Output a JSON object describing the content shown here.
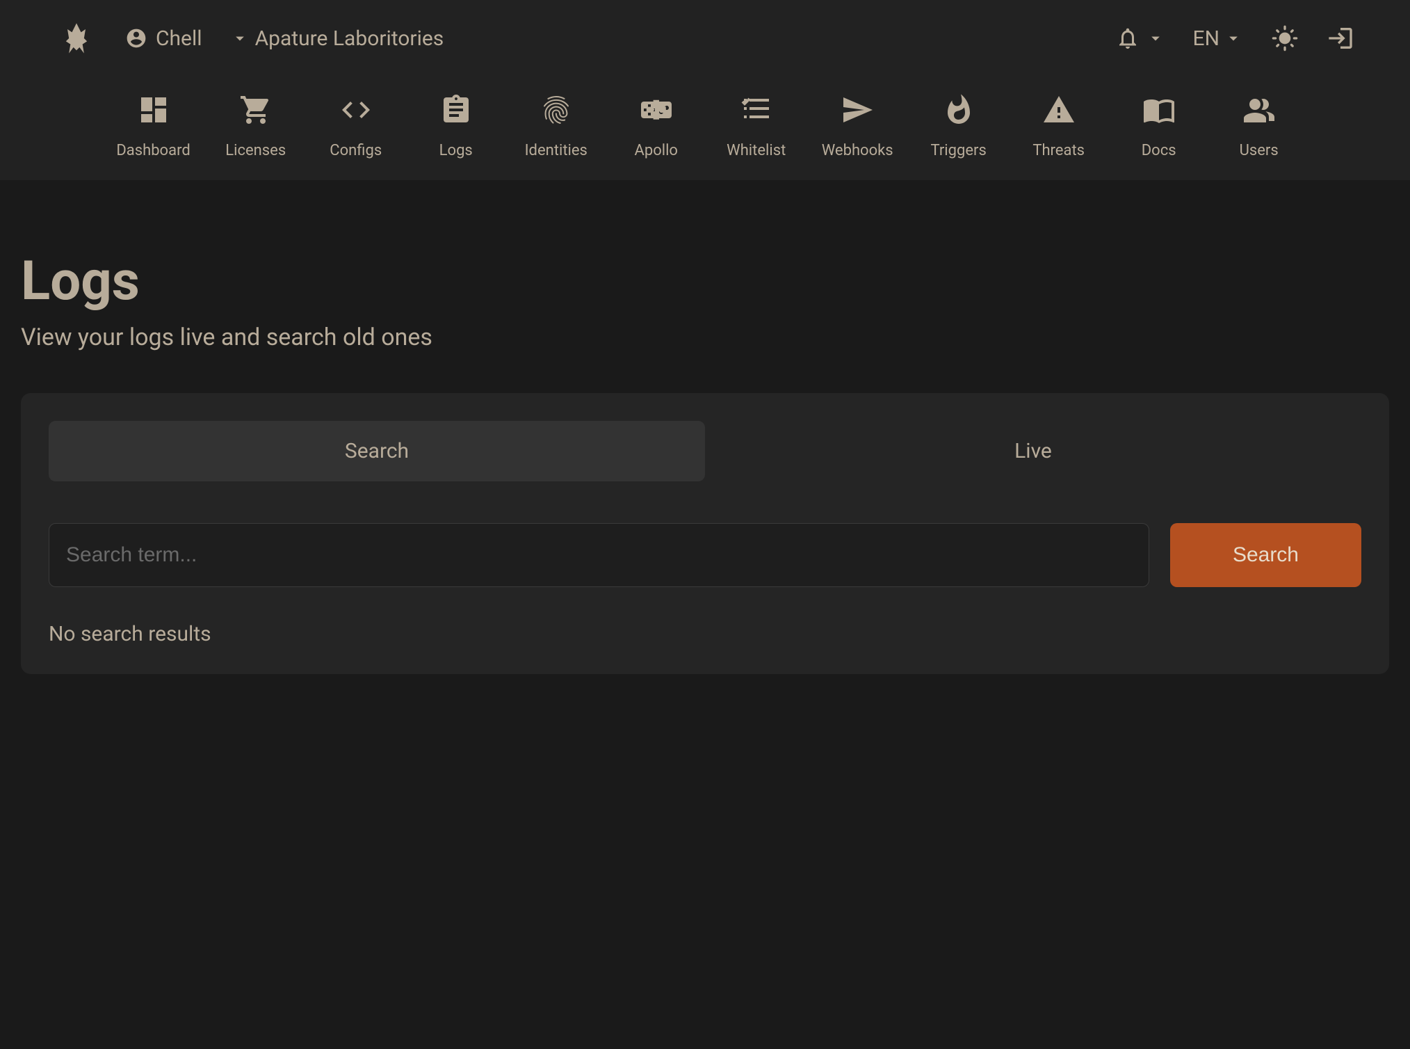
{
  "header": {
    "user_name": "Chell",
    "org_name": "Apature Laboritories",
    "language": "EN"
  },
  "nav": {
    "items": [
      {
        "label": "Dashboard"
      },
      {
        "label": "Licenses"
      },
      {
        "label": "Configs"
      },
      {
        "label": "Logs"
      },
      {
        "label": "Identities"
      },
      {
        "label": "Apollo"
      },
      {
        "label": "Whitelist"
      },
      {
        "label": "Webhooks"
      },
      {
        "label": "Triggers"
      },
      {
        "label": "Threats"
      },
      {
        "label": "Docs"
      },
      {
        "label": "Users"
      }
    ]
  },
  "page": {
    "title": "Logs",
    "subtitle": "View your logs live and search old ones"
  },
  "logs": {
    "tabs": {
      "search": "Search",
      "live": "Live"
    },
    "search_placeholder": "Search term...",
    "search_button": "Search",
    "no_results": "No search results"
  }
}
